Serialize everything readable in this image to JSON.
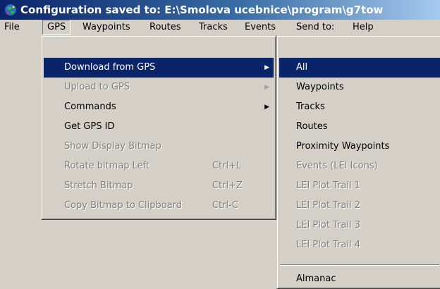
{
  "window": {
    "title": "Configuration saved to: E:\\Smolova ucebnice\\program\\g7tow"
  },
  "menubar": {
    "items": [
      "File",
      "GPS",
      "Waypoints",
      "Routes",
      "Tracks",
      "Events",
      "Send to:",
      "Help"
    ]
  },
  "gps_menu": {
    "items": [
      {
        "label": "Download from GPS",
        "shortcut": "",
        "state": "highlighted",
        "submenu": true
      },
      {
        "label": "Upload to GPS",
        "shortcut": "",
        "state": "disabled",
        "submenu": true
      },
      {
        "label": "Commands",
        "shortcut": "",
        "state": "enabled",
        "submenu": true
      },
      {
        "label": "Get GPS ID",
        "shortcut": "",
        "state": "enabled",
        "submenu": false
      },
      {
        "label": "Show Display Bitmap",
        "shortcut": "",
        "state": "disabled",
        "submenu": false
      },
      {
        "label": "Rotate bitmap Left",
        "shortcut": "Ctrl+L",
        "state": "disabled",
        "submenu": false
      },
      {
        "label": "Stretch Bitmap",
        "shortcut": "Ctrl+Z",
        "state": "disabled",
        "submenu": false
      },
      {
        "label": "Copy Bitmap to Clipboard",
        "shortcut": "Ctrl-C",
        "state": "disabled",
        "submenu": false
      }
    ]
  },
  "download_submenu": {
    "items": [
      {
        "label": "All",
        "state": "highlighted"
      },
      {
        "label": "Waypoints",
        "state": "enabled"
      },
      {
        "label": "Tracks",
        "state": "enabled"
      },
      {
        "label": "Routes",
        "state": "enabled"
      },
      {
        "label": "Proximity Waypoints",
        "state": "enabled"
      },
      {
        "label": "Events (LEI Icons)",
        "state": "disabled"
      },
      {
        "label": "LEI Plot Trail 1",
        "state": "disabled"
      },
      {
        "label": "LEI Plot Trail 2",
        "state": "disabled"
      },
      {
        "label": "LEI Plot Trail 3",
        "state": "disabled"
      },
      {
        "label": "LEI Plot Trail 4",
        "state": "disabled"
      },
      {
        "label": "Almanac",
        "state": "enabled"
      }
    ]
  },
  "icons": {
    "submenu_arrow": "▶"
  },
  "colors": {
    "highlight": "#0a246a",
    "menu_face": "#d4d0c8",
    "disabled_text": "#808080"
  }
}
